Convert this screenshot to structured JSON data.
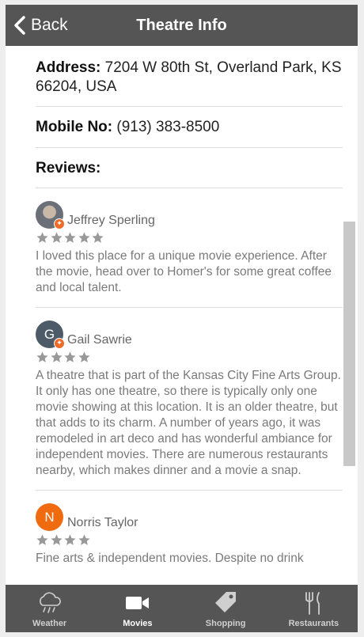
{
  "header": {
    "back_label": "Back",
    "title": "Theatre Info"
  },
  "info": {
    "address_label": "Address:",
    "address_value": "7204 W 80th St, Overland Park, KS 66204, USA",
    "mobile_label": "Mobile No:",
    "mobile_value": "(913) 383-8500",
    "reviews_heading": "Reviews:"
  },
  "reviews": [
    {
      "name": "Jeffrey Sperling",
      "avatar": "photo",
      "rating": 5,
      "text": "I loved this place for a unique movie experience. After the movie, head over to Homer's for some great coffee and local talent."
    },
    {
      "name": "Gail Sawrie",
      "avatar": "G",
      "rating": 4,
      "text": "A theatre that is part of the Kansas City Fine Arts Group. It only has one theatre, so there is typically only one movie showing at this location. It is an older theatre, but that adds to its charm. A number of years ago, it was remodeled in art deco and has wonderful ambiance for independent movies. There are numerous restaurants nearby, which makes dinner and a movie a snap."
    },
    {
      "name": "Norris Taylor",
      "avatar": "N",
      "rating": 4,
      "text": "Fine arts & independent movies. Despite no drink"
    }
  ],
  "tabs": [
    {
      "label": "Weather",
      "icon": "cloud-rain-icon",
      "active": false
    },
    {
      "label": "Movies",
      "icon": "video-camera-icon",
      "active": true
    },
    {
      "label": "Shopping",
      "icon": "tag-icon",
      "active": false
    },
    {
      "label": "Restaurants",
      "icon": "fork-knife-icon",
      "active": false
    }
  ],
  "colors": {
    "header_bg": "#555555",
    "star": "#999999",
    "badge": "#ee6b2a",
    "avatar_n": "#f06a0f"
  }
}
